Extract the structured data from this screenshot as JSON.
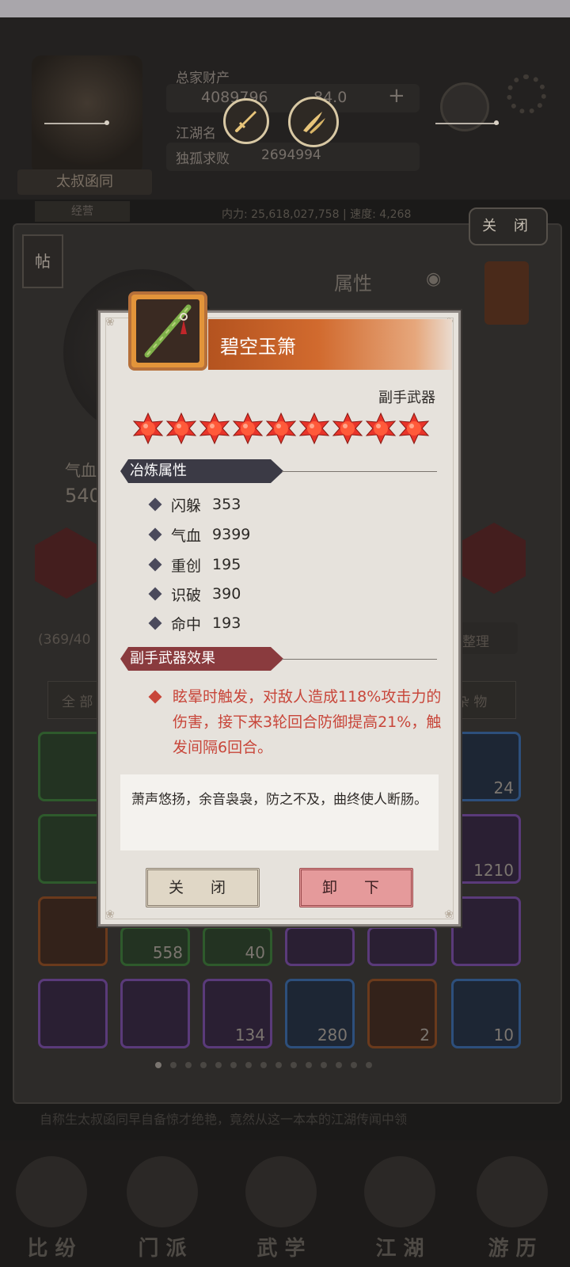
{
  "background": {
    "player_name": "太叔函同",
    "player_rank": "经营",
    "stat_top_label": "总家财产",
    "gold_value": "4089796",
    "gold_suffix": "84.0",
    "region_label": "江湖名",
    "undefeated_label": "独孤求败",
    "undefeated_value": "2694994",
    "power_text": "内力: 25,618,027,758 | 速度: 4,268",
    "close_label": "关 闭",
    "tie_label": "帖",
    "attr_title": "属性",
    "hp_label": "气血",
    "hp_value": "540",
    "bag_count": "(369/40",
    "sort_label": "整理",
    "tab_all": "全 部",
    "tab_misc": "杂 物",
    "tile_counts": [
      "24",
      "1210",
      "558",
      "40",
      "134",
      "280",
      "2",
      "10"
    ],
    "story_line1": "自称生太叔函同早自备惊才绝艳，竟然从这一本本的江湖传闻中领",
    "nav_labels": [
      "比 纷",
      "门 派",
      "武 学",
      "江 湖",
      "游 历"
    ]
  },
  "dialog": {
    "item_name": "碧空玉箫",
    "item_type": "副手武器",
    "star_count": 9,
    "section_refine": "冶炼属性",
    "attributes": [
      {
        "name": "闪躲",
        "value": "353"
      },
      {
        "name": "气血",
        "value": "9399"
      },
      {
        "name": "重创",
        "value": "195"
      },
      {
        "name": "识破",
        "value": "390"
      },
      {
        "name": "命中",
        "value": "193"
      }
    ],
    "section_effect": "副手武器效果",
    "effect_text": "眩晕时触发，对敌人造成118%攻击力的伤害，接下来3轮回合防御提高21%，触发间隔6回合。",
    "description": "萧声悠扬，余音袅袅，防之不及，曲终使人断肠。",
    "close_button": "关 闭",
    "unequip_button": "卸 下"
  },
  "colors": {
    "header_orange": "#c75f27",
    "star_red": "#e8342a",
    "effect_red": "#c8463a",
    "section_dark": "#3b3a45",
    "section_maroon": "#8a3b3e"
  },
  "icons": {
    "sword_button": "sword-icon",
    "daggers_button": "daggers-icon",
    "settings": "gear-icon",
    "eye": "eye-icon",
    "item": "jade-flute-icon"
  }
}
